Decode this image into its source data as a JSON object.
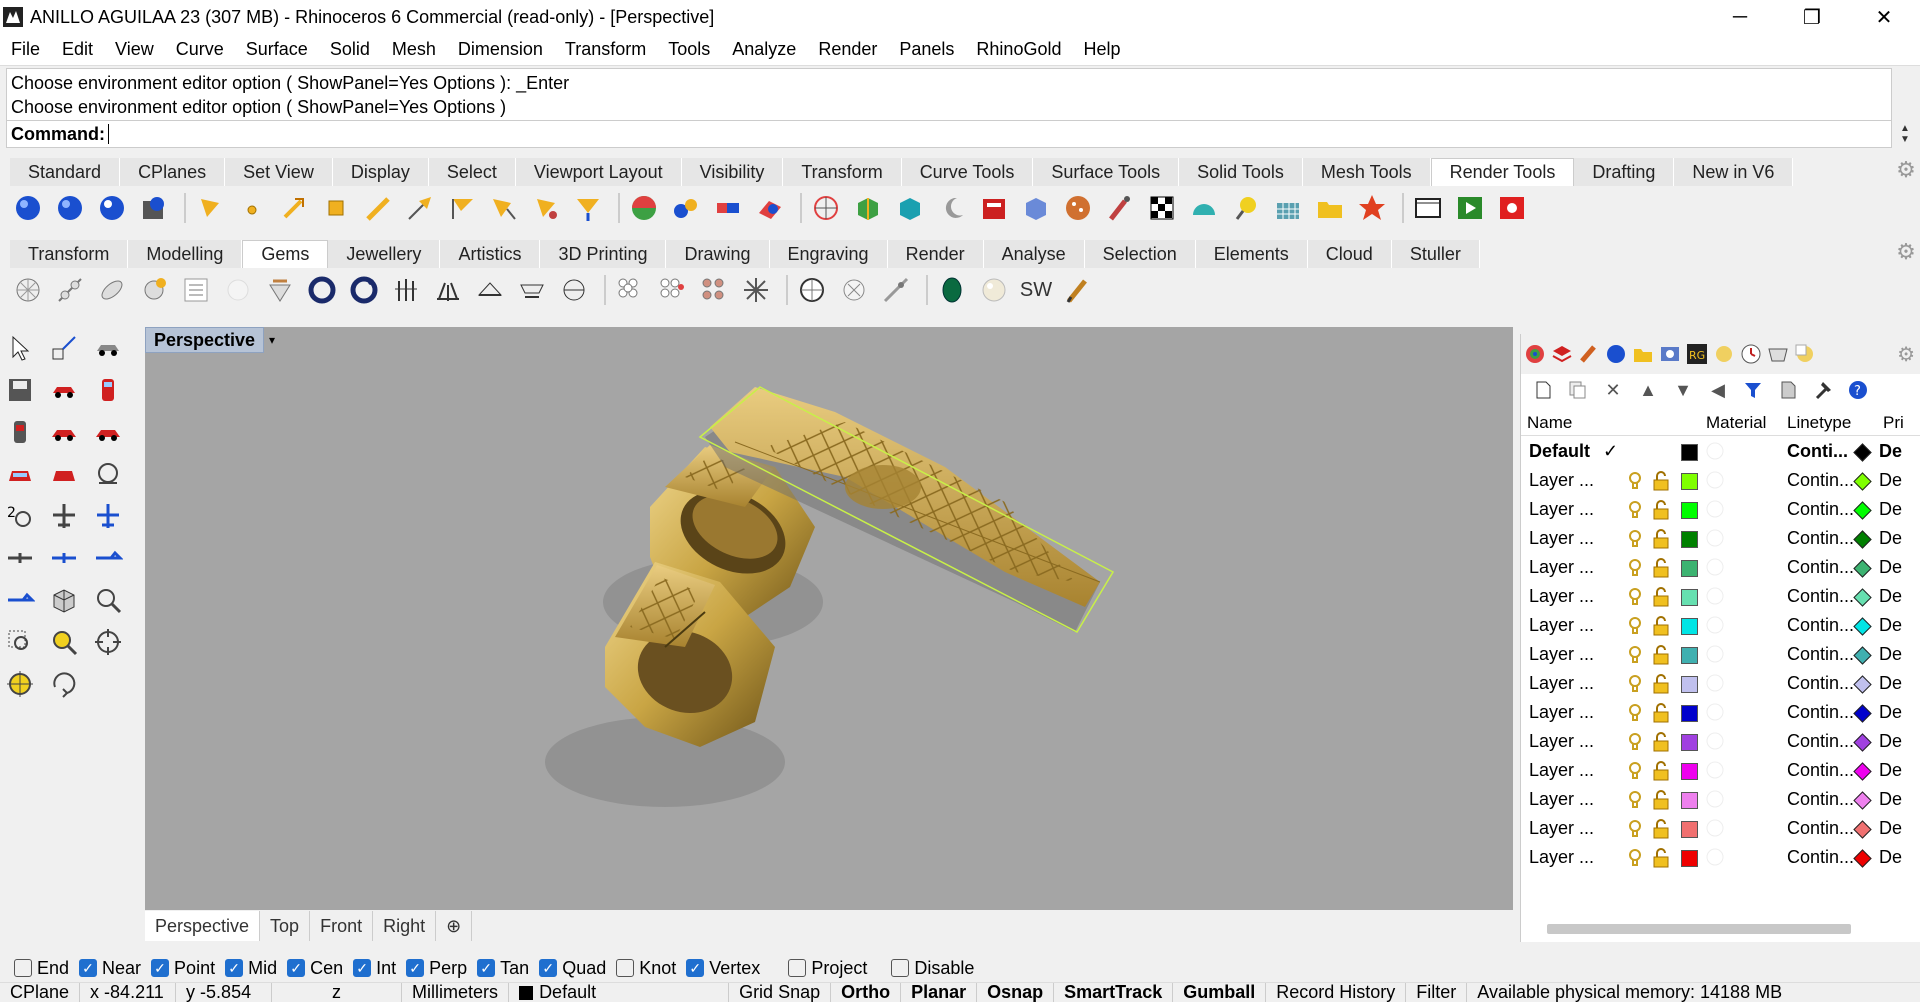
{
  "window": {
    "title": "ANILLO AGUILAA 23 (307 MB) - Rhinoceros 6 Commercial (read-only) - [Perspective]",
    "minimize": "─",
    "restore": "❐",
    "close": "✕"
  },
  "menu": [
    "File",
    "Edit",
    "View",
    "Curve",
    "Surface",
    "Solid",
    "Mesh",
    "Dimension",
    "Transform",
    "Tools",
    "Analyze",
    "Render",
    "Panels",
    "RhinoGold",
    "Help"
  ],
  "command": {
    "history": [
      "Choose environment editor option ( ShowPanel=Yes  Options ): _Enter",
      "Choose environment editor option ( ShowPanel=Yes  Options )"
    ],
    "prompt": "Command:"
  },
  "toolbar_tabs_1": [
    "Standard",
    "CPlanes",
    "Set View",
    "Display",
    "Select",
    "Viewport Layout",
    "Visibility",
    "Transform",
    "Curve Tools",
    "Surface Tools",
    "Solid Tools",
    "Mesh Tools",
    "Render Tools",
    "Drafting",
    "New in V6"
  ],
  "toolbar_tabs_1_active": "Render Tools",
  "toolbar_tabs_2": [
    "Transform",
    "Modelling",
    "Gems",
    "Jewellery",
    "Artistics",
    "3D Printing",
    "Drawing",
    "Engraving",
    "Render",
    "Analyse",
    "Selection",
    "Elements",
    "Cloud",
    "Stuller"
  ],
  "toolbar_tabs_2_active": "Gems",
  "gems_sw_label": "SW",
  "viewport": {
    "title": "Perspective",
    "dropdown": "▾",
    "tabs": [
      "Perspective",
      "Top",
      "Front",
      "Right"
    ],
    "add_tab": "⊕"
  },
  "layers": {
    "headers": {
      "name": "Name",
      "material": "Material",
      "linetype": "Linetype",
      "print": "Pri"
    },
    "rows": [
      {
        "name": "Default",
        "current": "✓",
        "color": "#000000",
        "linetype": "Conti...",
        "print": "De",
        "bold": true
      },
      {
        "name": "Layer ...",
        "color": "#7fff00",
        "linetype": "Contin...",
        "print": "De"
      },
      {
        "name": "Layer ...",
        "color": "#00ff00",
        "linetype": "Contin...",
        "print": "De"
      },
      {
        "name": "Layer ...",
        "color": "#008000",
        "linetype": "Contin...",
        "print": "De"
      },
      {
        "name": "Layer ...",
        "color": "#3cb371",
        "linetype": "Contin...",
        "print": "De"
      },
      {
        "name": "Layer ...",
        "color": "#66e0b0",
        "linetype": "Contin...",
        "print": "De"
      },
      {
        "name": "Layer ...",
        "color": "#00e5e5",
        "linetype": "Contin...",
        "print": "De"
      },
      {
        "name": "Layer ...",
        "color": "#40b0b0",
        "linetype": "Contin...",
        "print": "De"
      },
      {
        "name": "Layer ...",
        "color": "#c0c0ee",
        "linetype": "Contin...",
        "print": "De"
      },
      {
        "name": "Layer ...",
        "color": "#0000cc",
        "linetype": "Contin...",
        "print": "De"
      },
      {
        "name": "Layer ...",
        "color": "#a040e0",
        "linetype": "Contin...",
        "print": "De"
      },
      {
        "name": "Layer ...",
        "color": "#ee00ee",
        "linetype": "Contin...",
        "print": "De"
      },
      {
        "name": "Layer ...",
        "color": "#ee80ee",
        "linetype": "Contin...",
        "print": "De"
      },
      {
        "name": "Layer ...",
        "color": "#f07070",
        "linetype": "Contin...",
        "print": "De"
      },
      {
        "name": "Layer ...",
        "color": "#ee0000",
        "linetype": "Contin...",
        "print": "De"
      }
    ]
  },
  "osnap": [
    {
      "label": "End",
      "on": false
    },
    {
      "label": "Near",
      "on": true
    },
    {
      "label": "Point",
      "on": true
    },
    {
      "label": "Mid",
      "on": true
    },
    {
      "label": "Cen",
      "on": true
    },
    {
      "label": "Int",
      "on": true
    },
    {
      "label": "Perp",
      "on": true
    },
    {
      "label": "Tan",
      "on": true
    },
    {
      "label": "Quad",
      "on": true
    },
    {
      "label": "Knot",
      "on": false
    },
    {
      "label": "Vertex",
      "on": true
    },
    {
      "label": "Project",
      "on": false
    },
    {
      "label": "Disable",
      "on": false
    }
  ],
  "status": {
    "cplane": "CPlane",
    "x": "x -84.211",
    "y": "y -5.854",
    "z": "z",
    "units": "Millimeters",
    "layer": "Default",
    "gridsnap": "Grid Snap",
    "ortho": "Ortho",
    "planar": "Planar",
    "osnap": "Osnap",
    "smarttrack": "SmartTrack",
    "gumball": "Gumball",
    "history": "Record History",
    "filter": "Filter",
    "memory": "Available physical memory: 14188 MB"
  },
  "colors": {
    "viewport_bg": "#a5a5a5",
    "gold": "#c9a544",
    "selection": "#b8e040",
    "active_blue": "#1f6fcf"
  }
}
